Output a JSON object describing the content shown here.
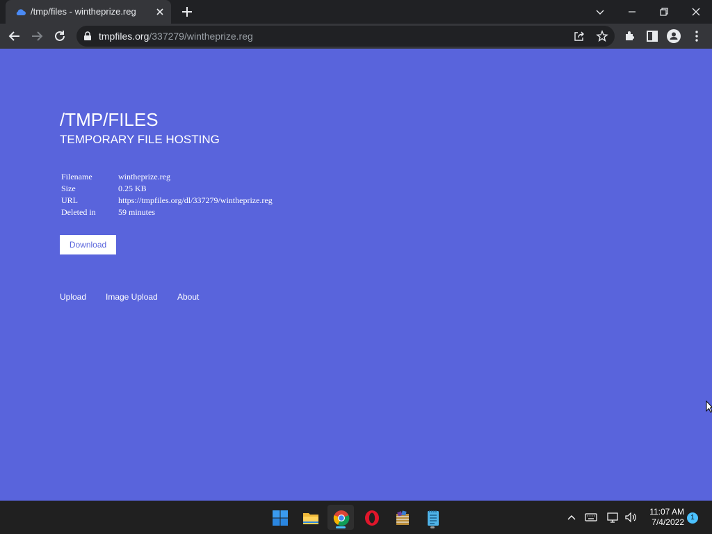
{
  "browser": {
    "tab_title": "/tmp/files - wintheprize.reg",
    "url_host": "tmpfiles.org",
    "url_path": "/337279/wintheprize.reg"
  },
  "page": {
    "title": "/TMP/FILES",
    "subtitle": "TEMPORARY FILE HOSTING",
    "file_info": [
      {
        "label": "Filename",
        "value": "wintheprize.reg"
      },
      {
        "label": "Size",
        "value": "0.25 KB"
      },
      {
        "label": "URL",
        "value": "https://tmpfiles.org/dl/337279/wintheprize.reg"
      },
      {
        "label": "Deleted in",
        "value": "59 minutes"
      }
    ],
    "download_label": "Download",
    "nav": {
      "upload": "Upload",
      "image_upload": "Image Upload",
      "about": "About"
    },
    "background_color": "#5964dc"
  },
  "taskbar": {
    "time": "11:07 AM",
    "date": "7/4/2022",
    "notification_count": "1",
    "apps": [
      "start-icon",
      "file-explorer-icon",
      "chrome-icon",
      "opera-icon",
      "winrar-icon",
      "notepad-icon"
    ]
  }
}
